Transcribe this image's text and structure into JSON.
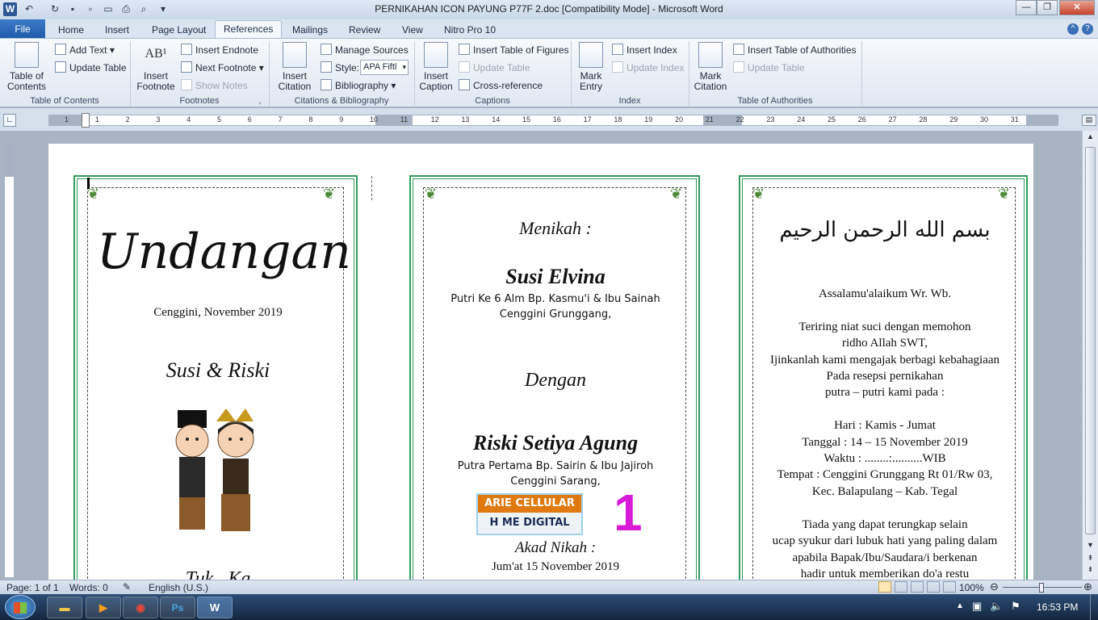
{
  "window": {
    "title": "PERNIKAHAN ICON PAYUNG P77F 2.doc [Compatibility Mode] - Microsoft Word",
    "app_icon": "W",
    "minimize": "—",
    "maximize": "❐",
    "close": "✕"
  },
  "tabs": {
    "file": "File",
    "items": [
      "Home",
      "Insert",
      "Page Layout",
      "References",
      "Mailings",
      "Review",
      "View",
      "Nitro Pro 10"
    ],
    "active": "References"
  },
  "ribbon": {
    "toc": {
      "label": "Table of Contents",
      "table_of_contents": "Table of\nContents",
      "add_text": "Add Text",
      "update_table": "Update Table"
    },
    "footnotes": {
      "label": "Footnotes",
      "insert_footnote": "Insert\nFootnote",
      "insert_endnote": "Insert Endnote",
      "next_footnote": "Next Footnote",
      "show_notes": "Show Notes"
    },
    "citations": {
      "label": "Citations & Bibliography",
      "insert_citation": "Insert\nCitation",
      "manage_sources": "Manage Sources",
      "style_label": "Style:",
      "style_value": "APA Fiftl",
      "bibliography": "Bibliography"
    },
    "captions": {
      "label": "Captions",
      "insert_caption": "Insert\nCaption",
      "insert_table_of_figures": "Insert Table of Figures",
      "update_table": "Update Table",
      "cross_reference": "Cross-reference"
    },
    "index": {
      "label": "Index",
      "mark_entry": "Mark\nEntry",
      "insert_index": "Insert Index",
      "update_index": "Update Index"
    },
    "authorities": {
      "label": "Table of Authorities",
      "mark_citation": "Mark\nCitation",
      "insert_toa": "Insert Table of Authorities",
      "update_table": "Update Table"
    }
  },
  "ruler": {
    "numbers": [
      "1",
      "1",
      "2",
      "3",
      "4",
      "5",
      "6",
      "7",
      "8",
      "9",
      "10",
      "11",
      "12",
      "13",
      "14",
      "15",
      "16",
      "17",
      "18",
      "19",
      "20",
      "21",
      "22",
      "23",
      "24",
      "25",
      "26",
      "27",
      "28",
      "29",
      "30",
      "31"
    ]
  },
  "document": {
    "card1": {
      "title": "Undangan",
      "location_date": "Cenggini, November 2019",
      "couple": "Susi & Riski",
      "bottom": "Tuk.. Ka"
    },
    "card2": {
      "heading": "Menikah :",
      "bride": "Susi Elvina",
      "bride_parents": "Putri Ke 6 Alm Bp. Kasmu'i & Ibu Sainah",
      "bride_address": "Cenggini Grunggang,",
      "with": "Dengan",
      "groom": "Riski Setiya Agung",
      "groom_parents": "Putra Pertama Bp. Sairin  & Ibu Jajiroh",
      "groom_address": "Cenggini Sarang,",
      "logo_top": "ARIE CELLULAR",
      "logo_bottom": "H  ME DIGITAL",
      "page_number": "1",
      "akad": "Akad Nikah :",
      "akad_date": "Jum'at 15 November 2019"
    },
    "card3": {
      "basmalah": "بسم الله الرحمن الرحيم",
      "lines": [
        "Assalamu'alaikum Wr. Wb.",
        "",
        "Teriring niat suci dengan memohon",
        "ridho Allah SWT,",
        "Ijinkanlah kami mengajak berbagi kebahagiaan",
        "Pada resepsi pernikahan",
        "putra – putri kami pada :",
        "",
        "Hari : Kamis - Jumat",
        "Tanggal : 14 – 15 November 2019",
        "Waktu : ........:..........WIB",
        "Tempat : Cenggini Grunggang Rt 01/Rw 03,",
        "Kec. Balapulang – Kab. Tegal",
        "",
        "Tiada yang dapat terungkap selain",
        "ucap syukur dari lubuk hati yang paling dalam",
        "apabila Bapak/Ibu/Saudara/i berkenan",
        "hadir untuk memberikan  do'a restu"
      ]
    }
  },
  "status": {
    "page": "Page: 1 of 1",
    "words": "Words: 0",
    "language": "English (U.S.)",
    "zoom": "100%"
  },
  "taskbar": {
    "time": "16:53 PM",
    "apps": [
      "Windows Explorer",
      "Media Player",
      "Google Chrome",
      "Photoshop",
      "Microsoft Word"
    ]
  },
  "colors": {
    "accent": "#2b5797",
    "card_border": "#2f9d5a",
    "page_number": "#d61ad6",
    "taskbar": "#1d3556"
  }
}
